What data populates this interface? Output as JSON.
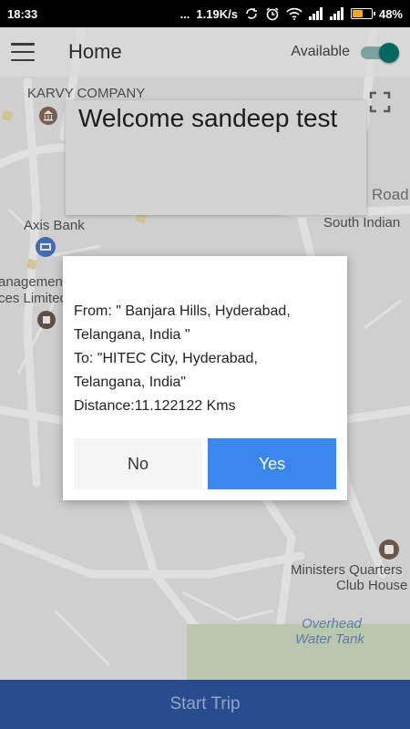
{
  "status_bar": {
    "time": "18:33",
    "dots": "...",
    "speed": "1.19K/s",
    "battery_percent": "48%",
    "battery_level": 0.48,
    "icons": [
      "sync-icon",
      "alarm-icon",
      "wifi-icon",
      "signal-icon",
      "signal-icon",
      "battery-icon"
    ]
  },
  "app_bar": {
    "title": "Home",
    "available_label": "Available",
    "available_on": true,
    "menu_icon": "menu-icon"
  },
  "welcome": {
    "text": "Welcome sandeep test"
  },
  "map": {
    "labels": {
      "karvy": "KARVY COMPANY",
      "road": "Road",
      "south_indian": "South Indian",
      "axis_bank": "Axis Bank",
      "management": "anagement",
      "ces_limited": "ces Limited",
      "ministers_1": "Ministers Quarters",
      "ministers_2": "Club House",
      "overhead_1": "Overhead",
      "overhead_2": "Water Tank"
    }
  },
  "dialog": {
    "from_line1": "From: \" Banjara Hills, Hyderabad,",
    "from_line2": "Telangana, India \"",
    "to_line1": "To: \"HITEC City, Hyderabad,",
    "to_line2": "Telangana, India\"",
    "distance": "Distance:11.122122 Kms",
    "no_label": "No",
    "yes_label": "Yes"
  },
  "bottom_bar": {
    "start_trip_label": "Start Trip"
  },
  "colors": {
    "appbar_bg": "#fafafa",
    "toggle_on": "#00796b",
    "yes_button": "#3a86ec",
    "bottom_bar": "#294c8c",
    "bottom_text": "#8ea4cc"
  }
}
